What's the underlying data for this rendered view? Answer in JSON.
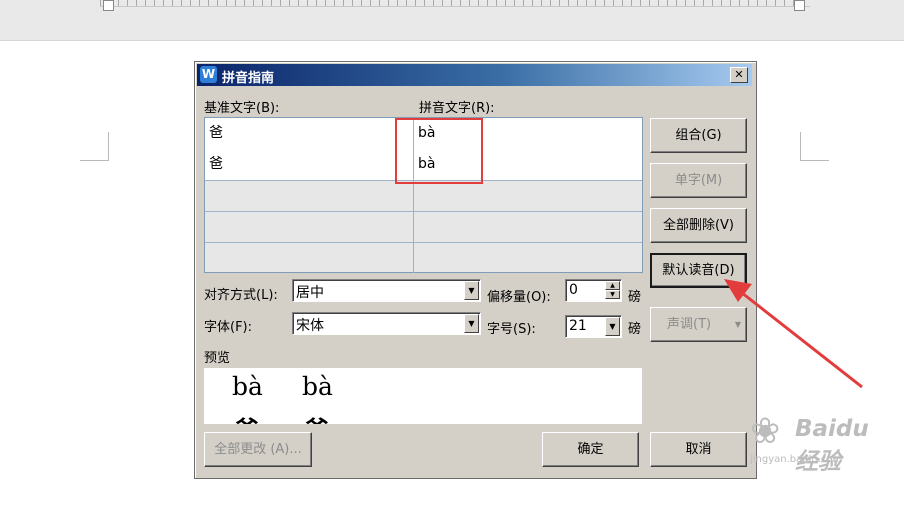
{
  "dialog": {
    "title": "拼音指南",
    "app_icon_letter": "W",
    "close_glyph": "✕",
    "base_text_label": "基准文字(B):",
    "pinyin_text_label": "拼音文字(R):",
    "rows": [
      {
        "base": "爸",
        "pinyin": "bà"
      },
      {
        "base": "爸",
        "pinyin": "bà"
      },
      {
        "base": "",
        "pinyin": ""
      },
      {
        "base": "",
        "pinyin": ""
      },
      {
        "base": "",
        "pinyin": ""
      }
    ],
    "buttons": {
      "group": "组合(G)",
      "single": "单字(M)",
      "delete_all": "全部删除(V)",
      "default_reading": "默认读音(D)",
      "tone": "声调(T)",
      "change_all": "全部更改 (A)...",
      "ok": "确定",
      "cancel": "取消"
    },
    "alignment": {
      "label": "对齐方式(L):",
      "value": "居中"
    },
    "offset": {
      "label": "偏移量(O):",
      "value": "0",
      "unit": "磅"
    },
    "font": {
      "label": "字体(F):",
      "value": "宋体"
    },
    "font_size": {
      "label": "字号(S):",
      "value": "21",
      "unit": "磅"
    },
    "preview": {
      "label": "预览",
      "pinyin1": "bà",
      "pinyin2": "bà",
      "char1": "爸",
      "char2": "爸"
    }
  },
  "watermark": {
    "brand": "Baidu",
    "suffix": "经验",
    "url": "jingyan.baidu.com",
    "paw_glyph": "❀"
  },
  "colors": {
    "highlight": "#e23c3c",
    "titlebar_start": "#0a246a",
    "dialog_bg": "#d4d0c8"
  }
}
